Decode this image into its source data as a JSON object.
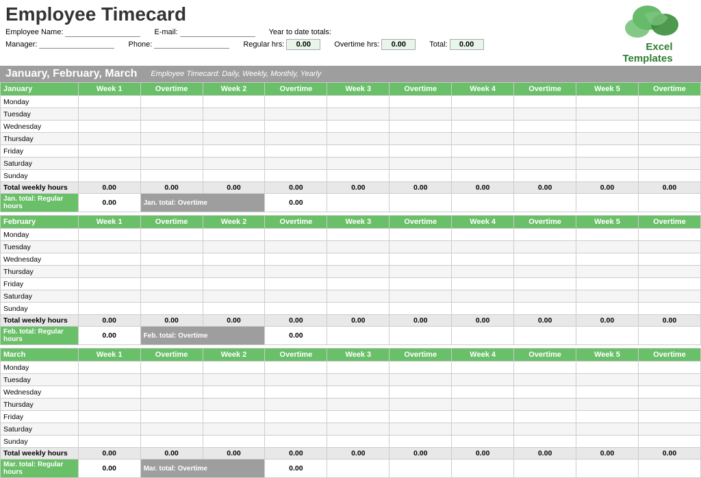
{
  "header": {
    "title": "Employee Timecard",
    "logo_text_line1": "Excel",
    "logo_text_line2": "Templates",
    "employee_label": "Employee Name:",
    "manager_label": "Manager:",
    "email_label": "E-mail:",
    "phone_label": "Phone:",
    "ytd_label": "Year to date totals:",
    "regular_hrs_label": "Regular hrs:",
    "overtime_hrs_label": "Overtime hrs:",
    "total_label": "Total:",
    "regular_hrs_value": "0.00",
    "overtime_hrs_value": "0.00",
    "total_value": "0.00"
  },
  "month_bar": {
    "months": "January, February, March",
    "subtitle": "Employee Timecard: Daily, Weekly, Monthly, Yearly"
  },
  "columns": [
    "",
    "Week 1",
    "Overtime",
    "Week 2",
    "Overtime",
    "Week 3",
    "Overtime",
    "Week 4",
    "Overtime",
    "Week 5",
    "Overtime"
  ],
  "days": [
    "Monday",
    "Tuesday",
    "Wednesday",
    "Thursday",
    "Friday",
    "Saturday",
    "Sunday"
  ],
  "months": [
    {
      "name": "January",
      "total_row_label": "Total weekly hours",
      "total_values": [
        "0.00",
        "0.00",
        "0.00",
        "0.00",
        "0.00",
        "0.00",
        "0.00",
        "0.00",
        "0.00",
        "0.00"
      ],
      "reg_label": "Jan. total: Regular hours",
      "reg_value": "0.00",
      "ot_label": "Jan. total: Overtime",
      "ot_value": "0.00"
    },
    {
      "name": "February",
      "total_row_label": "Total weekly hours",
      "total_values": [
        "0.00",
        "0.00",
        "0.00",
        "0.00",
        "0.00",
        "0.00",
        "0.00",
        "0.00",
        "0.00",
        "0.00"
      ],
      "reg_label": "Feb. total: Regular hours",
      "reg_value": "0.00",
      "ot_label": "Feb. total: Overtime",
      "ot_value": "0.00"
    },
    {
      "name": "March",
      "total_row_label": "Total weekly hours",
      "total_values": [
        "0.00",
        "0.00",
        "0.00",
        "0.00",
        "0.00",
        "0.00",
        "0.00",
        "0.00",
        "0.00",
        "0.00"
      ],
      "reg_label": "Mar. total: Regular hours",
      "reg_value": "0.00",
      "ot_label": "Mar. total: Overtime",
      "ot_value": "0.00"
    }
  ]
}
